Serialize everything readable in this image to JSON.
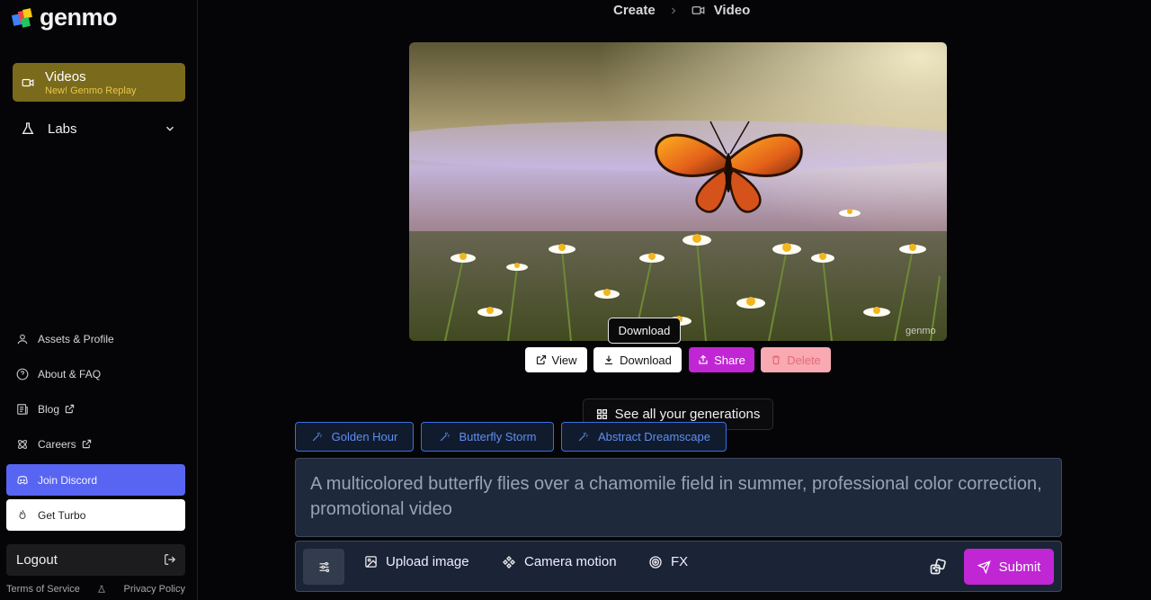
{
  "app": {
    "name": "genmo"
  },
  "sidebar": {
    "videos": {
      "label": "Videos",
      "sublabel": "New! Genmo Replay"
    },
    "labs": {
      "label": "Labs"
    },
    "links": [
      {
        "label": "Assets & Profile"
      },
      {
        "label": "About & FAQ"
      },
      {
        "label": "Blog"
      },
      {
        "label": "Careers"
      },
      {
        "label": "Join Discord"
      },
      {
        "label": "Get Turbo"
      }
    ],
    "logout": "Logout",
    "footer": {
      "terms": "Terms of Service",
      "privacy": "Privacy Policy"
    }
  },
  "breadcrumb": {
    "root": "Create",
    "current": "Video"
  },
  "video": {
    "watermark": "genmo",
    "tooltip": "Download"
  },
  "actions": {
    "view": "View",
    "download": "Download",
    "share": "Share",
    "delete": "Delete"
  },
  "see_all": "See all your generations",
  "suggestions": [
    "Golden Hour",
    "Butterfly Storm",
    "Abstract Dreamscape"
  ],
  "prompt": {
    "text": "A multicolored butterfly flies over a chamomile field in summer, professional color correction, promotional video"
  },
  "toolbar": {
    "upload": "Upload image",
    "camera": "Camera motion",
    "fx": "FX",
    "submit": "Submit"
  },
  "colors": {
    "accent": "#c026d3",
    "chip_border": "#3b6fe0",
    "discord": "#5865f2",
    "videos_bg": "#7a6a1c"
  }
}
